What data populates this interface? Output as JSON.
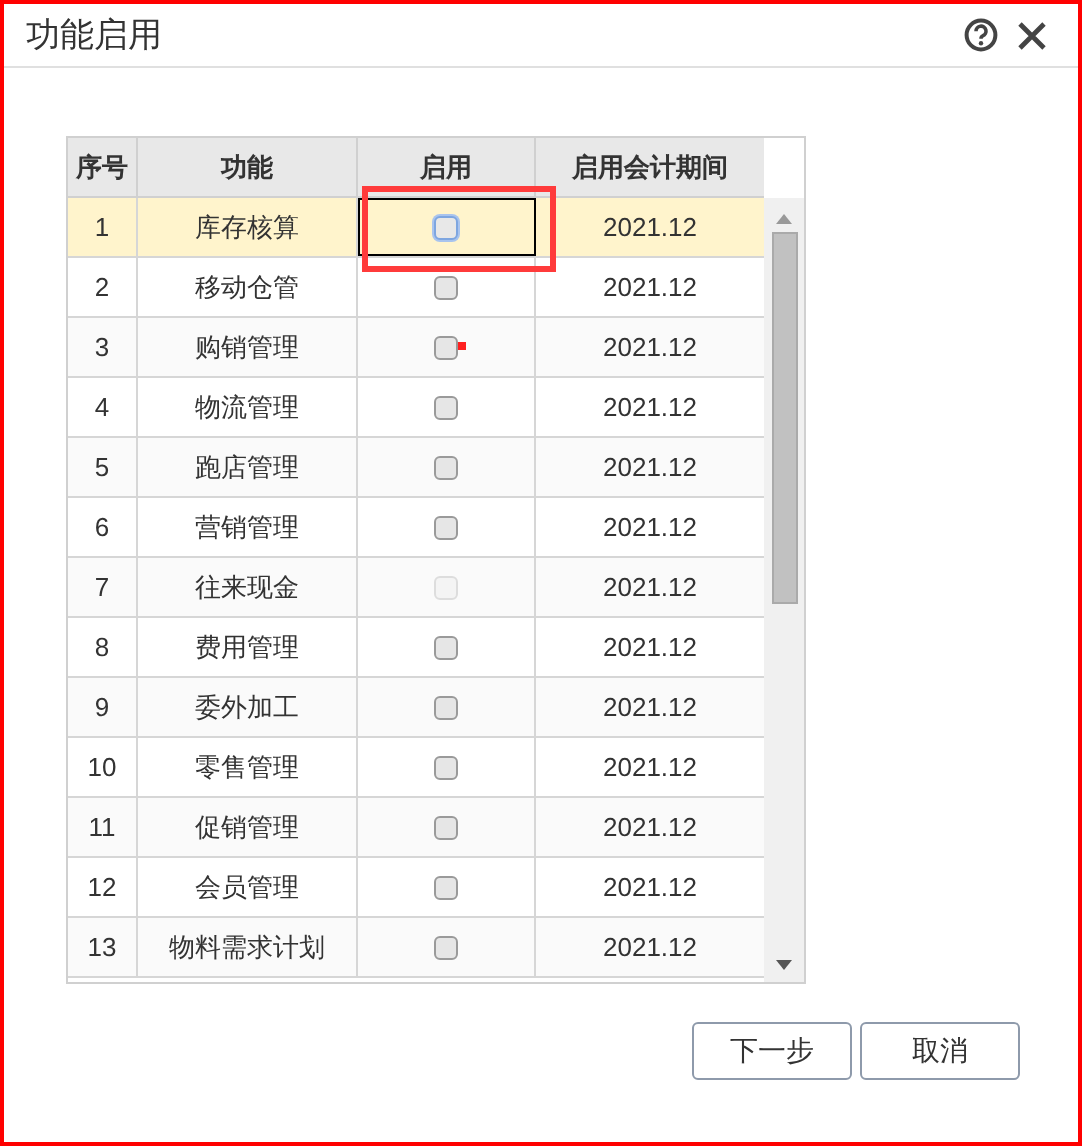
{
  "window": {
    "title": "功能启用"
  },
  "table": {
    "columns": [
      "序号",
      "功能",
      "启用",
      "启用会计期间"
    ],
    "rows": [
      {
        "index": "1",
        "feature": "库存核算",
        "checked": false,
        "disabled": false,
        "selected": true,
        "annotated": true,
        "marked": false,
        "period": "2021.12"
      },
      {
        "index": "2",
        "feature": "移动仓管",
        "checked": false,
        "disabled": false,
        "selected": false,
        "annotated": false,
        "marked": false,
        "period": "2021.12"
      },
      {
        "index": "3",
        "feature": "购销管理",
        "checked": false,
        "disabled": false,
        "selected": false,
        "annotated": false,
        "marked": true,
        "period": "2021.12"
      },
      {
        "index": "4",
        "feature": "物流管理",
        "checked": false,
        "disabled": false,
        "selected": false,
        "annotated": false,
        "marked": false,
        "period": "2021.12"
      },
      {
        "index": "5",
        "feature": "跑店管理",
        "checked": false,
        "disabled": false,
        "selected": false,
        "annotated": false,
        "marked": false,
        "period": "2021.12"
      },
      {
        "index": "6",
        "feature": "营销管理",
        "checked": false,
        "disabled": false,
        "selected": false,
        "annotated": false,
        "marked": false,
        "period": "2021.12"
      },
      {
        "index": "7",
        "feature": "往来现金",
        "checked": false,
        "disabled": true,
        "selected": false,
        "annotated": false,
        "marked": false,
        "period": "2021.12"
      },
      {
        "index": "8",
        "feature": "费用管理",
        "checked": false,
        "disabled": false,
        "selected": false,
        "annotated": false,
        "marked": false,
        "period": "2021.12"
      },
      {
        "index": "9",
        "feature": "委外加工",
        "checked": false,
        "disabled": false,
        "selected": false,
        "annotated": false,
        "marked": false,
        "period": "2021.12"
      },
      {
        "index": "10",
        "feature": "零售管理",
        "checked": false,
        "disabled": false,
        "selected": false,
        "annotated": false,
        "marked": false,
        "period": "2021.12"
      },
      {
        "index": "11",
        "feature": "促销管理",
        "checked": false,
        "disabled": false,
        "selected": false,
        "annotated": false,
        "marked": false,
        "period": "2021.12"
      },
      {
        "index": "12",
        "feature": "会员管理",
        "checked": false,
        "disabled": false,
        "selected": false,
        "annotated": false,
        "marked": false,
        "period": "2021.12"
      },
      {
        "index": "13",
        "feature": "物料需求计划",
        "checked": false,
        "disabled": false,
        "selected": false,
        "annotated": false,
        "marked": false,
        "period": "2021.12"
      }
    ]
  },
  "buttons": [
    "下一步",
    "取消"
  ]
}
